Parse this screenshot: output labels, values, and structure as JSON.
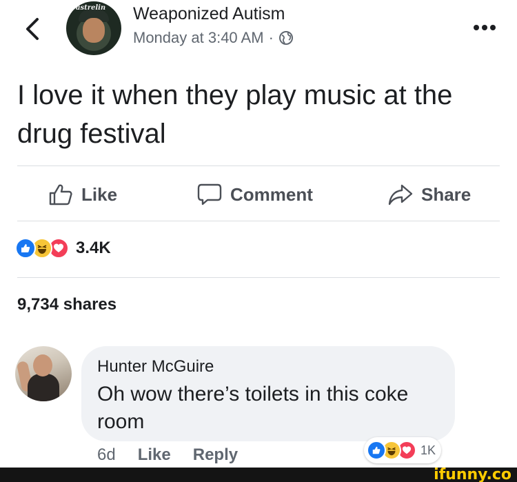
{
  "post": {
    "author": "Weaponized Autism",
    "timestamp": "Monday at 3:40 AM",
    "separator": "·",
    "privacy_icon": "globe-icon",
    "text": "I love it when they play music at the drug festival",
    "avatar_text": "Castrelin"
  },
  "actions": {
    "like": "Like",
    "comment": "Comment",
    "share": "Share"
  },
  "reactions": {
    "count": "3.4K",
    "types": [
      "like",
      "haha",
      "love"
    ]
  },
  "shares": "9,734 shares",
  "comment": {
    "author": "Hunter McGuire",
    "text": "Oh wow there’s toilets in this coke room",
    "time": "6d",
    "like": "Like",
    "reply": "Reply",
    "reaction_count": "1K"
  },
  "watermark": "ifunny.co",
  "colors": {
    "like_blue": "#1877f2",
    "haha_yellow": "#f7c538",
    "love_red": "#f33e58",
    "bubble_gray": "#f0f2f5",
    "watermark_yellow": "#ffcc00"
  }
}
